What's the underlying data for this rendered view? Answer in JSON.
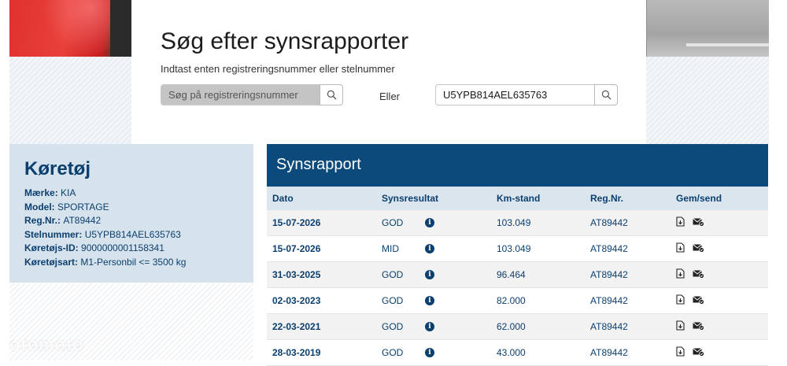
{
  "search": {
    "title": "Søg efter synsrapporter",
    "subtitle": "Indtast enten registreringsnummer eller stelnummer",
    "reg_placeholder": "Søg på registreringsnummer",
    "or_label": "Eller",
    "vin_value": "U5YPB814AEL635763"
  },
  "vehicle": {
    "title": "Køretøj",
    "fields": [
      {
        "key": "Mærke",
        "value": "KIA"
      },
      {
        "key": "Model",
        "value": "SPORTAGE"
      },
      {
        "key": "Reg.Nr.",
        "value": "AT89442"
      },
      {
        "key": "Stelnummer",
        "value": "U5YPB814AEL635763"
      },
      {
        "key": "Køretøjs-ID",
        "value": "9000000001158341"
      },
      {
        "key": "Køretøjsart",
        "value": "M1-Personbil <= 3500 kg"
      }
    ]
  },
  "report": {
    "title": "Synsrapport",
    "columns": [
      "Dato",
      "Synsresultat",
      "Km-stand",
      "Reg.Nr.",
      "Gem/send"
    ],
    "rows": [
      {
        "date": "15-07-2026",
        "result": "GOD",
        "km": "103.049",
        "reg": "AT89442"
      },
      {
        "date": "15-07-2026",
        "result": "MID",
        "km": "103.049",
        "reg": "AT89442"
      },
      {
        "date": "31-03-2025",
        "result": "GOD",
        "km": "96.464",
        "reg": "AT89442"
      },
      {
        "date": "02-03-2023",
        "result": "GOD",
        "km": "82.000",
        "reg": "AT89442"
      },
      {
        "date": "22-03-2021",
        "result": "GOD",
        "km": "62.000",
        "reg": "AT89442"
      },
      {
        "date": "28-03-2019",
        "result": "GOD",
        "km": "43.000",
        "reg": "AT89442"
      }
    ]
  },
  "icons": {
    "search": "search-icon",
    "info": "info-icon",
    "download": "download-file-icon",
    "email": "send-email-icon"
  },
  "watermark": "otomoto",
  "colors": {
    "brand_blue": "#0b4a7a",
    "vehicle_panel": "#d6e2ec"
  }
}
